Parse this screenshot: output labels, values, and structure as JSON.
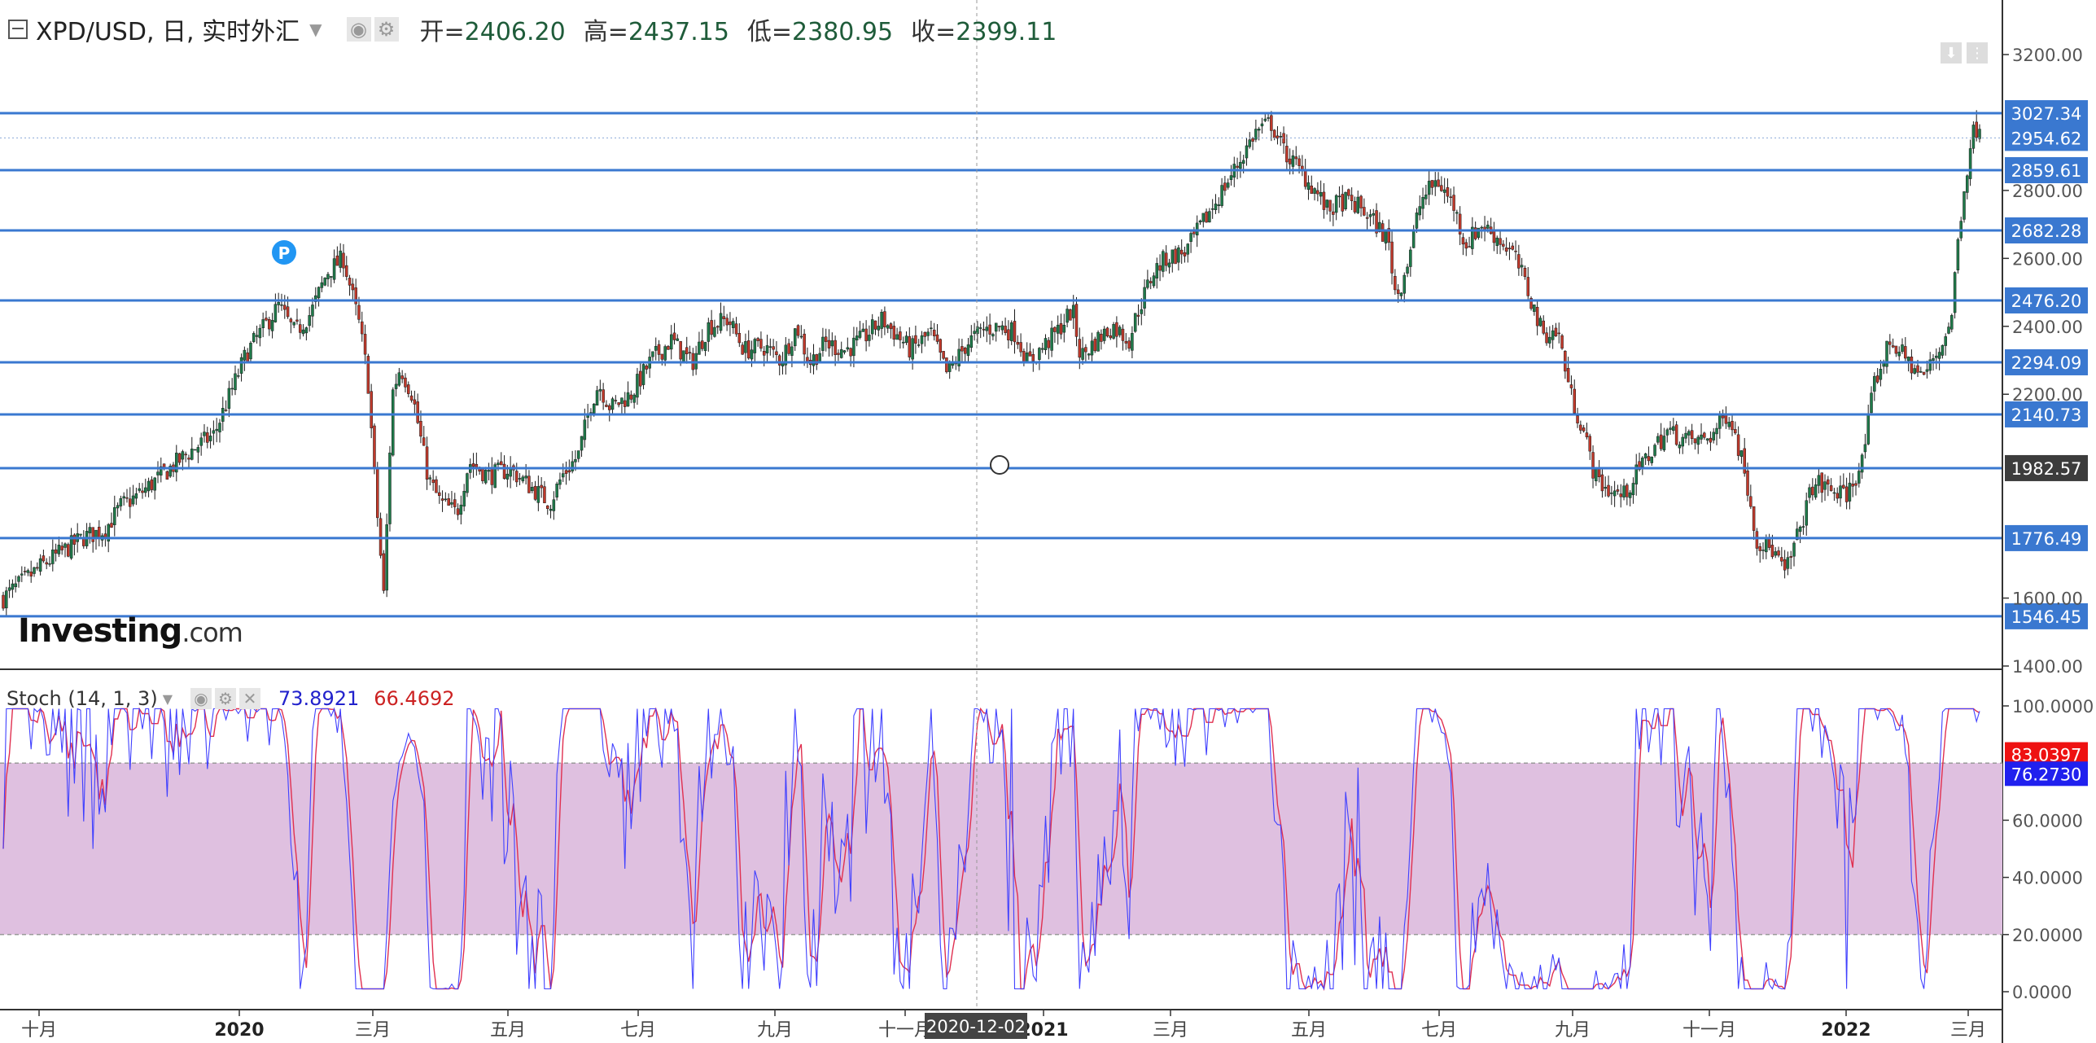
{
  "header": {
    "symbol": "XPD/USD, 日, 实时外汇",
    "open_label": "开=",
    "open": "2406.20",
    "high_label": "高=",
    "high": "2437.15",
    "low_label": "低=",
    "low": "2380.95",
    "close_label": "收=",
    "close": "2399.11"
  },
  "stoch_header": {
    "label": "Stoch (14, 1, 3)",
    "k_value": "73.8921",
    "d_value": "66.4692"
  },
  "logo": {
    "main": "Investing",
    "suffix": ".com"
  },
  "cursor_date": "2020-12-02",
  "colors": {
    "up": "#1f7a4a",
    "down": "#c0392b",
    "level": "#3a78d0",
    "stoch_band": "#dfc0e0",
    "k_line": "#4040ff",
    "d_line": "#e03050"
  },
  "chart_data": {
    "type": "candlestick",
    "price_axis": {
      "min": 1400,
      "max": 3200,
      "ticks": [
        "3200.00",
        "2800.00",
        "2600.00",
        "2400.00",
        "2200.00",
        "1600.00",
        "1400.00"
      ]
    },
    "x_labels": [
      "十月",
      "2020",
      "三月",
      "五月",
      "七月",
      "九月",
      "十一月",
      "2021",
      "三月",
      "五月",
      "七月",
      "九月",
      "十一月",
      "2022",
      "三月"
    ],
    "levels": [
      {
        "label": "3027.34",
        "value": 3027.34,
        "style": "box"
      },
      {
        "label": "2954.62",
        "value": 2954.62,
        "style": "box-dotted"
      },
      {
        "label": "2859.61",
        "value": 2859.61,
        "style": "box"
      },
      {
        "label": "2682.28",
        "value": 2682.28,
        "style": "box"
      },
      {
        "label": "2476.20",
        "value": 2476.2,
        "style": "box"
      },
      {
        "label": "2294.09",
        "value": 2294.09,
        "style": "box"
      },
      {
        "label": "2140.73",
        "value": 2140.73,
        "style": "box"
      },
      {
        "label": "1982.57",
        "value": 1982.57,
        "style": "dark"
      },
      {
        "label": "1776.49",
        "value": 1776.49,
        "style": "box"
      },
      {
        "label": "1546.45",
        "value": 1546.45,
        "style": "box"
      }
    ],
    "price_path": [
      [
        0,
        1600
      ],
      [
        50,
        1650
      ],
      [
        100,
        1700
      ],
      [
        150,
        1740
      ],
      [
        200,
        1780
      ],
      [
        250,
        1800
      ],
      [
        290,
        1870
      ],
      [
        330,
        1900
      ],
      [
        380,
        1950
      ],
      [
        420,
        1990
      ],
      [
        470,
        2040
      ],
      [
        520,
        2080
      ],
      [
        560,
        2200
      ],
      [
        600,
        2320
      ],
      [
        640,
        2390
      ],
      [
        680,
        2460
      ],
      [
        720,
        2380
      ],
      [
        760,
        2440
      ],
      [
        800,
        2560
      ],
      [
        840,
        2600
      ],
      [
        880,
        2400
      ],
      [
        900,
        2250
      ],
      [
        920,
        1900
      ],
      [
        940,
        1600
      ],
      [
        960,
        2200
      ],
      [
        980,
        2280
      ],
      [
        1010,
        2200
      ],
      [
        1050,
        1950
      ],
      [
        1080,
        1880
      ],
      [
        1120,
        1850
      ],
      [
        1150,
        2000
      ],
      [
        1200,
        1960
      ],
      [
        1250,
        1980
      ],
      [
        1300,
        1930
      ],
      [
        1350,
        1880
      ],
      [
        1380,
        1960
      ],
      [
        1420,
        2020
      ],
      [
        1450,
        2170
      ],
      [
        1470,
        2230
      ],
      [
        1500,
        2160
      ],
      [
        1550,
        2200
      ],
      [
        1600,
        2300
      ],
      [
        1650,
        2360
      ],
      [
        1700,
        2290
      ],
      [
        1740,
        2400
      ],
      [
        1790,
        2420
      ],
      [
        1830,
        2330
      ],
      [
        1880,
        2340
      ],
      [
        1920,
        2300
      ],
      [
        1960,
        2400
      ],
      [
        1990,
        2290
      ],
      [
        2030,
        2350
      ],
      [
        2080,
        2330
      ],
      [
        2120,
        2360
      ],
      [
        2170,
        2420
      ],
      [
        2210,
        2370
      ],
      [
        2240,
        2330
      ],
      [
        2290,
        2380
      ],
      [
        2330,
        2260
      ],
      [
        2380,
        2350
      ],
      [
        2420,
        2390
      ],
      [
        2460,
        2400
      ],
      [
        2500,
        2380
      ],
      [
        2530,
        2290
      ],
      [
        2560,
        2330
      ],
      [
        2600,
        2380
      ],
      [
        2640,
        2450
      ],
      [
        2660,
        2310
      ],
      [
        2700,
        2360
      ],
      [
        2740,
        2400
      ],
      [
        2780,
        2360
      ],
      [
        2800,
        2440
      ],
      [
        2840,
        2560
      ],
      [
        2870,
        2600
      ],
      [
        2920,
        2620
      ],
      [
        2960,
        2700
      ],
      [
        3010,
        2800
      ],
      [
        3050,
        2880
      ],
      [
        3090,
        2970
      ],
      [
        3130,
        3000
      ],
      [
        3160,
        2920
      ],
      [
        3200,
        2860
      ],
      [
        3240,
        2800
      ],
      [
        3270,
        2740
      ],
      [
        3310,
        2770
      ],
      [
        3350,
        2750
      ],
      [
        3390,
        2700
      ],
      [
        3420,
        2650
      ],
      [
        3440,
        2480
      ],
      [
        3470,
        2600
      ],
      [
        3500,
        2770
      ],
      [
        3540,
        2830
      ],
      [
        3580,
        2760
      ],
      [
        3610,
        2640
      ],
      [
        3650,
        2700
      ],
      [
        3690,
        2660
      ],
      [
        3730,
        2610
      ],
      [
        3760,
        2520
      ],
      [
        3800,
        2380
      ],
      [
        3840,
        2380
      ],
      [
        3870,
        2200
      ],
      [
        3900,
        2100
      ],
      [
        3930,
        1960
      ],
      [
        3960,
        1920
      ],
      [
        4000,
        1900
      ],
      [
        4040,
        1980
      ],
      [
        4080,
        2050
      ],
      [
        4110,
        2090
      ],
      [
        4150,
        2070
      ],
      [
        4180,
        2060
      ],
      [
        4220,
        2080
      ],
      [
        4260,
        2150
      ],
      [
        4300,
        1980
      ],
      [
        4330,
        1770
      ],
      [
        4370,
        1740
      ],
      [
        4400,
        1670
      ],
      [
        4430,
        1780
      ],
      [
        4470,
        1940
      ],
      [
        4510,
        1920
      ],
      [
        4550,
        1900
      ],
      [
        4590,
        2000
      ],
      [
        4620,
        2230
      ],
      [
        4660,
        2360
      ],
      [
        4700,
        2300
      ],
      [
        4740,
        2250
      ],
      [
        4780,
        2330
      ],
      [
        4810,
        2420
      ],
      [
        4830,
        2700
      ],
      [
        4860,
        2960
      ],
      [
        4880,
        3000
      ]
    ],
    "stoch": {
      "overbought": 80,
      "oversold": 20,
      "axis_ticks": [
        "100.0000",
        "60.0000",
        "40.0000",
        "20.0000",
        "0.0000"
      ],
      "k_last": "76.2730",
      "d_last": "83.0397"
    }
  }
}
